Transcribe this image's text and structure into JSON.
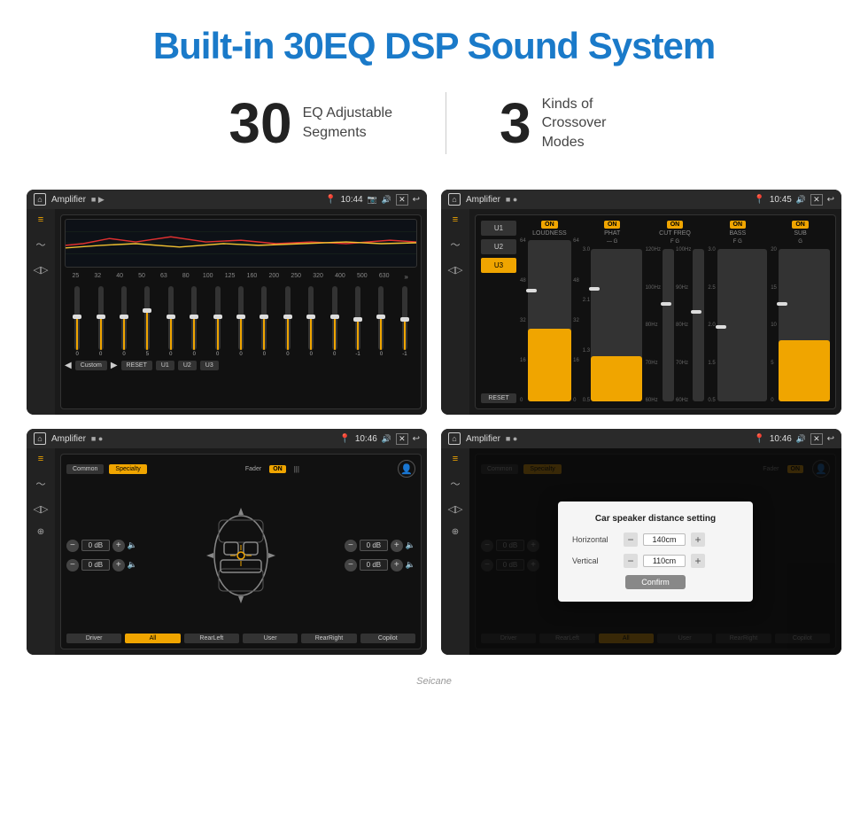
{
  "header": {
    "title": "Built-in 30EQ DSP Sound System"
  },
  "stats": [
    {
      "number": "30",
      "label": "EQ Adjustable\nSegments"
    },
    {
      "number": "3",
      "label": "Kinds of\nCrossover Modes"
    }
  ],
  "screen1": {
    "title": "Amplifier",
    "time": "10:44",
    "eq_freqs": [
      "25",
      "32",
      "40",
      "50",
      "63",
      "80",
      "100",
      "125",
      "160",
      "200",
      "250",
      "320",
      "400",
      "500",
      "630"
    ],
    "eq_values": [
      "0",
      "0",
      "0",
      "5",
      "0",
      "0",
      "0",
      "0",
      "0",
      "0",
      "0",
      "0",
      "-1",
      "0",
      "-1"
    ],
    "preset": "Custom",
    "buttons": [
      "RESET",
      "U1",
      "U2",
      "U3"
    ]
  },
  "screen2": {
    "title": "Amplifier",
    "time": "10:45",
    "presets": [
      "U1",
      "U2",
      "U3"
    ],
    "active_preset": "U3",
    "channels": [
      "LOUDNESS",
      "PHAT",
      "CUT FREQ",
      "BASS",
      "SUB"
    ],
    "toggles": [
      "ON",
      "ON",
      "ON",
      "ON",
      "ON"
    ],
    "reset": "RESET"
  },
  "screen3": {
    "title": "Amplifier",
    "time": "10:46",
    "tabs": [
      "Common",
      "Specialty"
    ],
    "active_tab": "Specialty",
    "fader_label": "Fader",
    "fader_on": "ON",
    "vol_rows": [
      {
        "value": "0 dB"
      },
      {
        "value": "0 dB"
      },
      {
        "value": "0 dB"
      },
      {
        "value": "0 dB"
      }
    ],
    "bottom_buttons": [
      "Driver",
      "RearLeft",
      "All",
      "User",
      "RearRight",
      "Copilot"
    ],
    "all_active": true
  },
  "screen4": {
    "title": "Amplifier",
    "time": "10:46",
    "tabs": [
      "Common",
      "Specialty"
    ],
    "active_tab": "Specialty",
    "dialog": {
      "title": "Car speaker distance setting",
      "horizontal_label": "Horizontal",
      "horizontal_value": "140cm",
      "vertical_label": "Vertical",
      "vertical_value": "110cm",
      "confirm_label": "Confirm"
    },
    "bottom_buttons": [
      "Driver",
      "RearLeft",
      "All",
      "User",
      "RearRight",
      "Copilot"
    ]
  },
  "watermark": "Seicane"
}
